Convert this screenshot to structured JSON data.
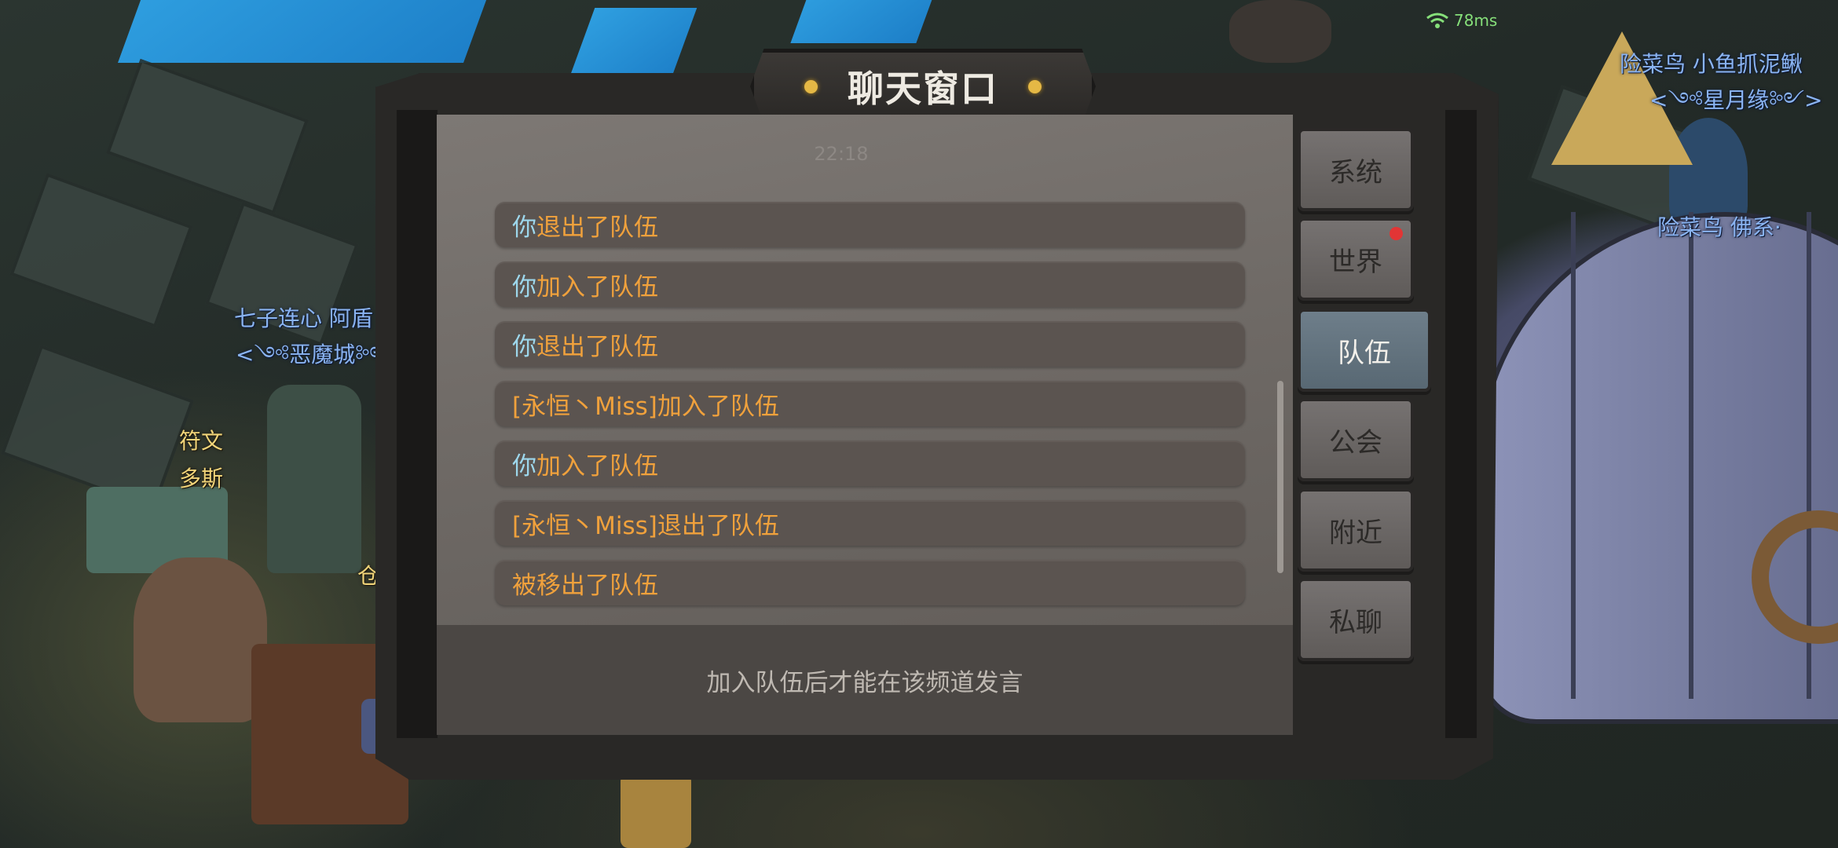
{
  "status": {
    "ping": "78ms"
  },
  "scene": {
    "npcs": [
      {
        "line1": "七子连心  阿盾",
        "line2": "<༺恶魔城༻>"
      },
      {
        "line1": "险菜鸟  小鱼抓泥鳅",
        "line2": "<༺星月缘༻>"
      },
      {
        "line1": "险菜鸟  佛系·"
      }
    ],
    "labels": {
      "rune": "符文",
      "dos": "多斯",
      "warehouse": "仓库"
    }
  },
  "chat_window": {
    "title": "聊天窗口",
    "timestamp": "22:18",
    "messages": [
      {
        "subject": "你",
        "action": "退出了队伍"
      },
      {
        "subject": "你",
        "action": "加入了队伍"
      },
      {
        "subject": "你",
        "action": "退出了队伍"
      },
      {
        "subject": "[永恒丶Miss]",
        "action": "加入了队伍"
      },
      {
        "subject": "你",
        "action": "加入了队伍"
      },
      {
        "subject": "[永恒丶Miss]",
        "action": "退出了队伍"
      },
      {
        "subject": "",
        "action": "被移出了队伍"
      }
    ],
    "input_hint": "加入队伍后才能在该频道发言",
    "tabs": [
      {
        "label": "系统",
        "active": false,
        "unread": false
      },
      {
        "label": "世界",
        "active": false,
        "unread": true
      },
      {
        "label": "队伍",
        "active": true,
        "unread": false
      },
      {
        "label": "公会",
        "active": false,
        "unread": false
      },
      {
        "label": "附近",
        "active": false,
        "unread": false
      },
      {
        "label": "私聊",
        "active": false,
        "unread": false
      }
    ]
  },
  "colors": {
    "self_name": "#9dd7ec",
    "action_text": "#f0a13c",
    "active_tab": "#6e7e8a",
    "unread_dot": "#e23535"
  }
}
